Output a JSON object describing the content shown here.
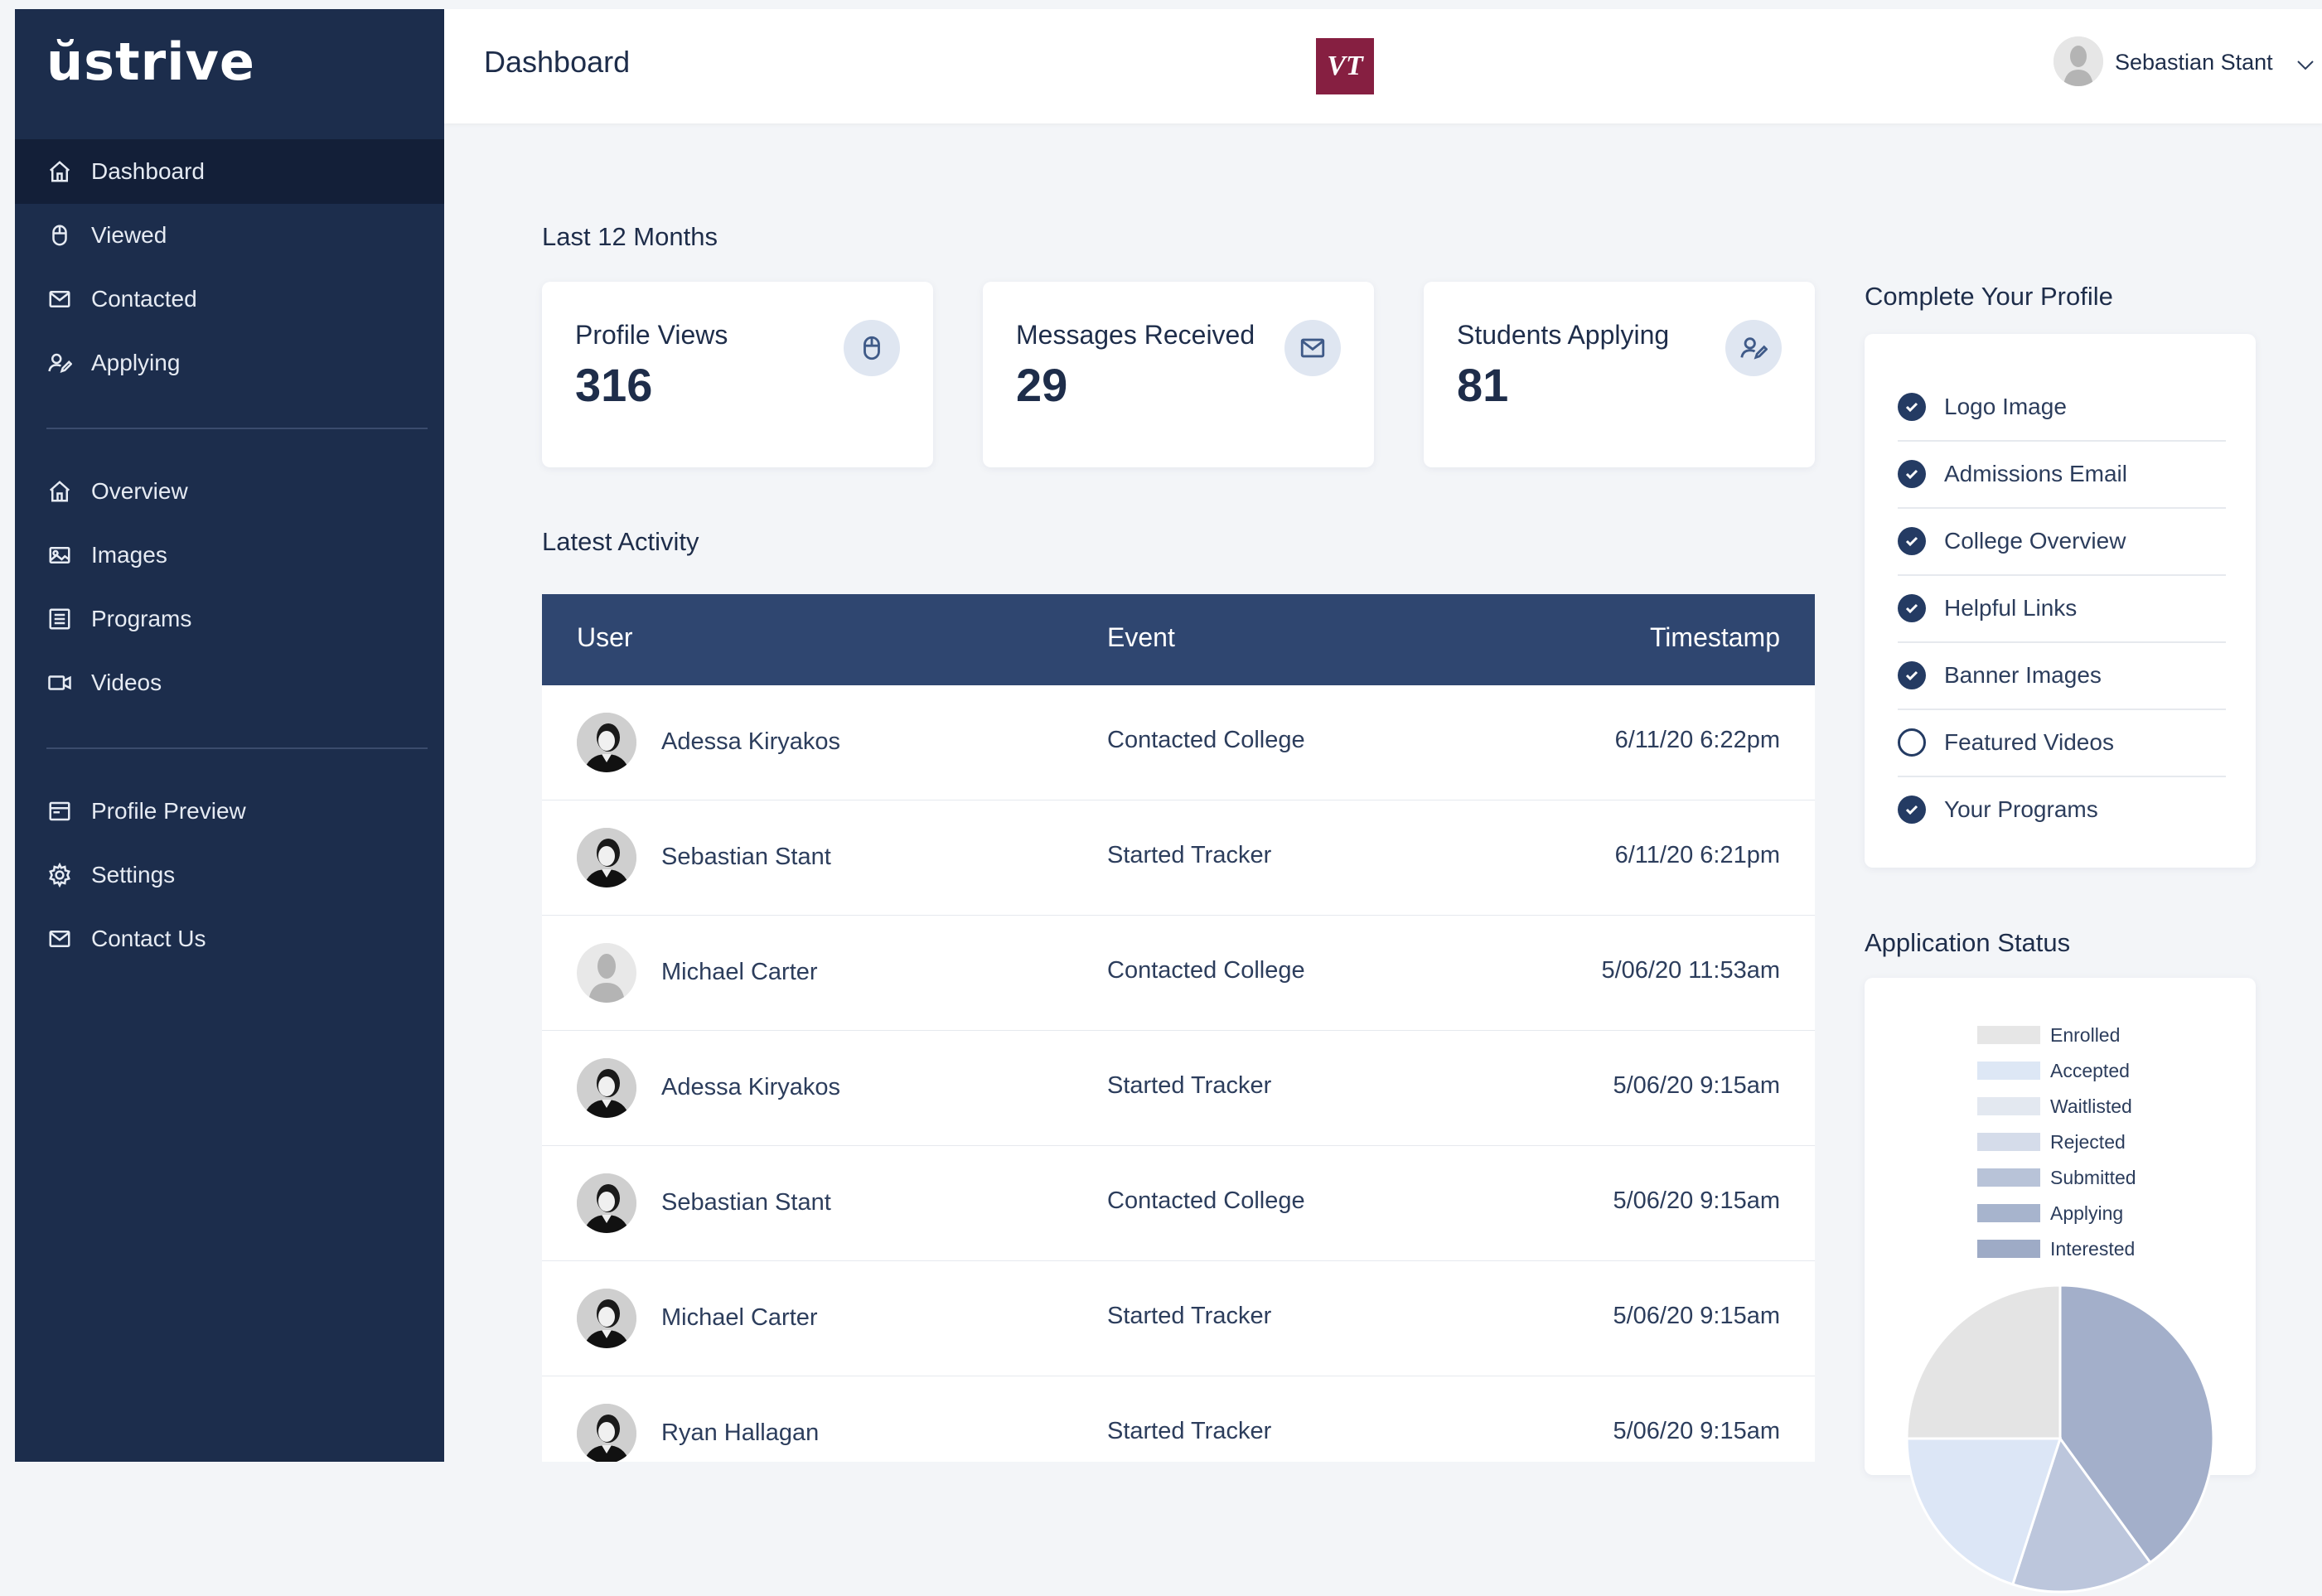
{
  "app": {
    "logo": "ŭstrive"
  },
  "sidebar": {
    "primary": [
      {
        "label": "Dashboard",
        "icon": "home-icon",
        "active": true
      },
      {
        "label": "Viewed",
        "icon": "mouse-icon"
      },
      {
        "label": "Contacted",
        "icon": "mail-icon"
      },
      {
        "label": "Applying",
        "icon": "user-edit-icon"
      }
    ],
    "secondary": [
      {
        "label": "Overview",
        "icon": "home-icon"
      },
      {
        "label": "Images",
        "icon": "images-icon"
      },
      {
        "label": "Programs",
        "icon": "list-icon"
      },
      {
        "label": "Videos",
        "icon": "video-icon"
      }
    ],
    "tertiary": [
      {
        "label": "Profile Preview",
        "icon": "browser-icon"
      },
      {
        "label": "Settings",
        "icon": "gear-icon"
      },
      {
        "label": "Contact Us",
        "icon": "mail-icon"
      }
    ]
  },
  "header": {
    "title": "Dashboard",
    "school_logo_text": "VT",
    "user_name": "Sebastian Stant"
  },
  "stats": {
    "heading": "Last 12 Months",
    "cards": [
      {
        "label": "Profile Views",
        "value": "316",
        "icon": "mouse-icon"
      },
      {
        "label": "Messages Received",
        "value": "29",
        "icon": "mail-icon"
      },
      {
        "label": "Students Applying",
        "value": "81",
        "icon": "user-edit-icon"
      }
    ]
  },
  "activity": {
    "heading": "Latest Activity",
    "columns": {
      "user": "User",
      "event": "Event",
      "timestamp": "Timestamp"
    },
    "rows": [
      {
        "user": "Adessa Kiryakos",
        "event": "Contacted College",
        "timestamp": "6/11/20 6:22pm",
        "avatar": "photo"
      },
      {
        "user": "Sebastian Stant",
        "event": "Started Tracker",
        "timestamp": "6/11/20 6:21pm",
        "avatar": "photo"
      },
      {
        "user": "Michael Carter",
        "event": "Contacted College",
        "timestamp": "5/06/20 11:53am",
        "avatar": "placeholder"
      },
      {
        "user": "Adessa Kiryakos",
        "event": "Started Tracker",
        "timestamp": "5/06/20 9:15am",
        "avatar": "photo"
      },
      {
        "user": "Sebastian Stant",
        "event": "Contacted College",
        "timestamp": "5/06/20 9:15am",
        "avatar": "photo"
      },
      {
        "user": "Michael Carter",
        "event": "Started Tracker",
        "timestamp": "5/06/20 9:15am",
        "avatar": "photo"
      },
      {
        "user": "Ryan Hallagan",
        "event": "Started Tracker",
        "timestamp": "5/06/20 9:15am",
        "avatar": "photo"
      }
    ]
  },
  "profile_checklist": {
    "heading": "Complete Your Profile",
    "items": [
      {
        "label": "Logo Image",
        "done": true
      },
      {
        "label": "Admissions Email",
        "done": true
      },
      {
        "label": "College Overview",
        "done": true
      },
      {
        "label": "Helpful Links",
        "done": true
      },
      {
        "label": "Banner Images",
        "done": true
      },
      {
        "label": "Featured Videos",
        "done": false
      },
      {
        "label": "Your Programs",
        "done": true
      }
    ]
  },
  "application_status": {
    "heading": "Application Status"
  },
  "chart_data": {
    "type": "pie",
    "series_names": [
      "Enrolled",
      "Accepted",
      "Waitlisted",
      "Rejected",
      "Submitted",
      "Applying",
      "Interested"
    ],
    "colors": [
      "#e6e6e6",
      "#dde7f5",
      "#e3e8f0",
      "#d5dcea",
      "#b8c3d8",
      "#a7b4cd",
      "#9eabc6"
    ],
    "visible_slices": [
      {
        "name": "Interested",
        "value": 40,
        "color": "#a3afca"
      },
      {
        "name": "Applying",
        "value": 15,
        "color": "#bcc6dc"
      },
      {
        "name": "Accepted",
        "value": 20,
        "color": "#dce6f6"
      },
      {
        "name": "Enrolled",
        "value": 25,
        "color": "#e4e4e4"
      }
    ]
  }
}
